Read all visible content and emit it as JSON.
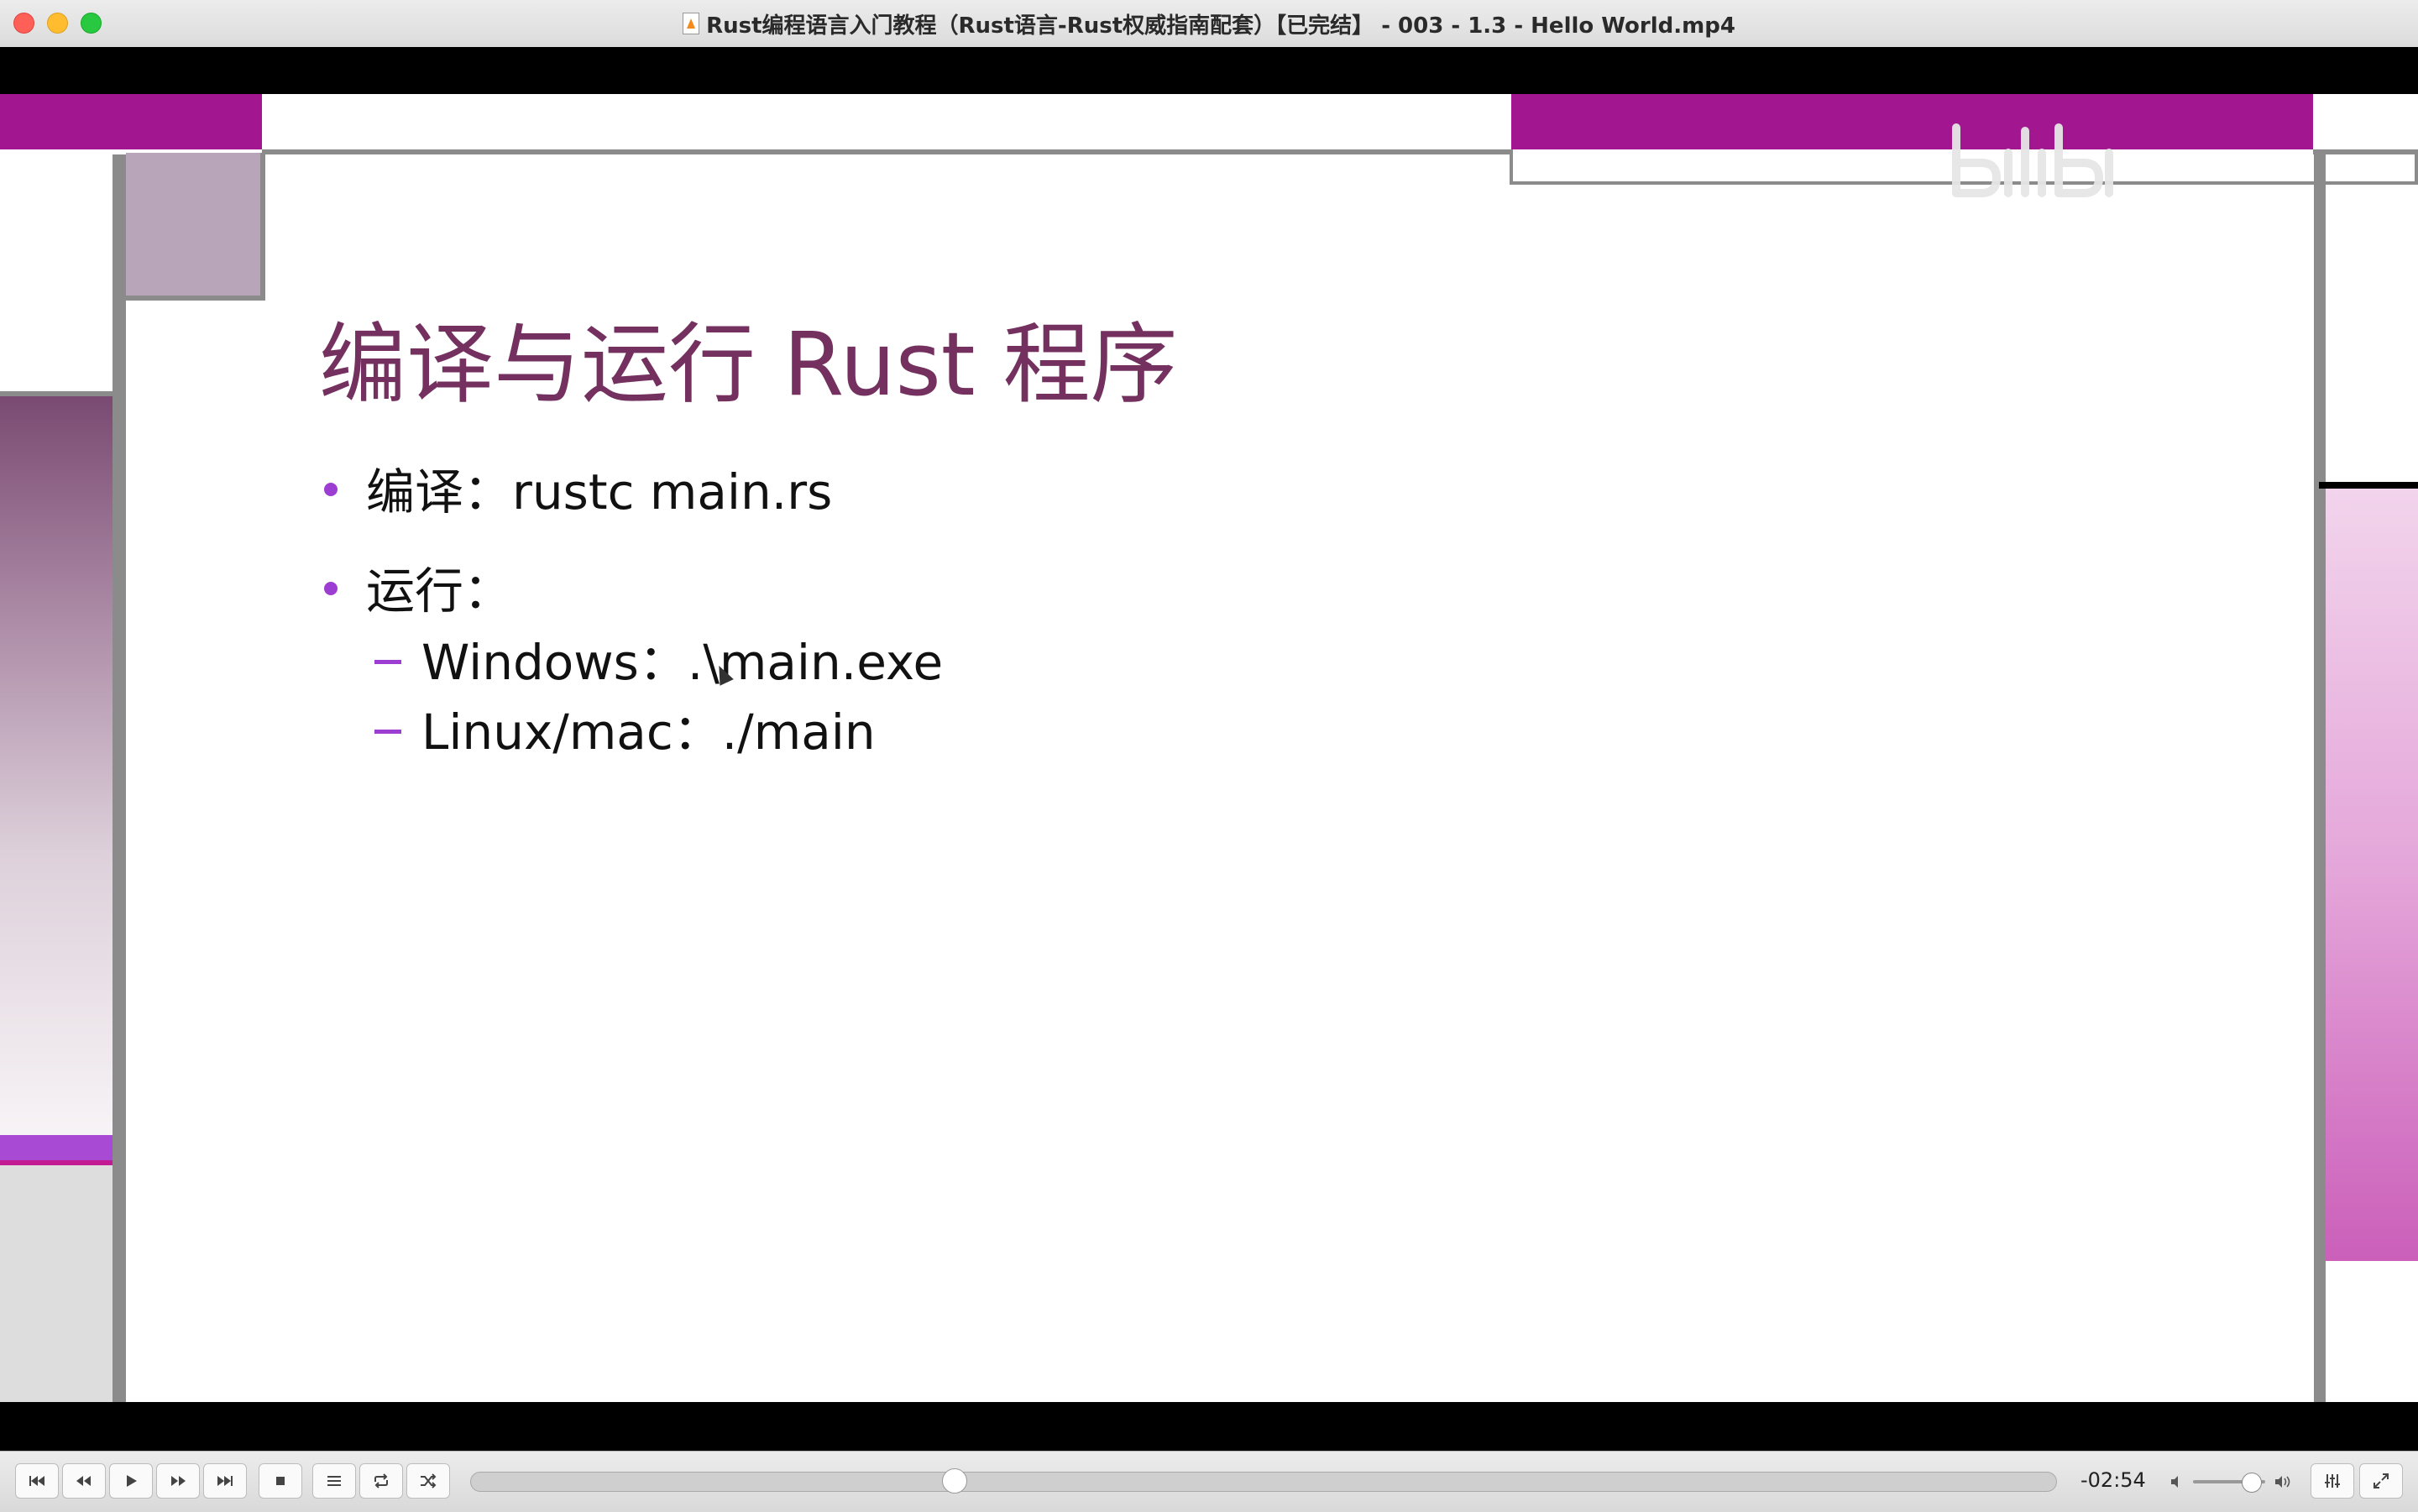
{
  "window": {
    "title": "Rust编程语言入门教程（Rust语言-Rust权威指南配套）【已完结】 - 003 - 1.3 - Hello World.mp4"
  },
  "slide": {
    "title": "编译与运行 Rust 程序",
    "bullets": [
      {
        "text": "编译：rustc main.rs"
      },
      {
        "text": "运行："
      }
    ],
    "sub_bullets": [
      {
        "text": "Windows：.\\main.exe"
      },
      {
        "text": "Linux/mac：./main"
      }
    ],
    "watermark": {
      "text": "",
      "logo": "bilibili"
    },
    "accent_colors": {
      "magenta": "#a2168f",
      "title": "#74305f",
      "bullet": "#9d3ed3"
    }
  },
  "player": {
    "time_remaining": "-02:54",
    "progress_fraction": 0.305,
    "volume_fraction": 0.8,
    "buttons": {
      "skip_back": "skip-to-start-icon",
      "rewind": "rewind-icon",
      "play": "play-icon",
      "fast_forward": "fast-forward-icon",
      "skip_forward": "skip-to-end-icon",
      "stop": "stop-icon",
      "playlist": "playlist-icon",
      "loop": "loop-icon",
      "shuffle": "shuffle-icon",
      "equalizer": "equalizer-icon",
      "fullscreen": "fullscreen-icon"
    }
  }
}
